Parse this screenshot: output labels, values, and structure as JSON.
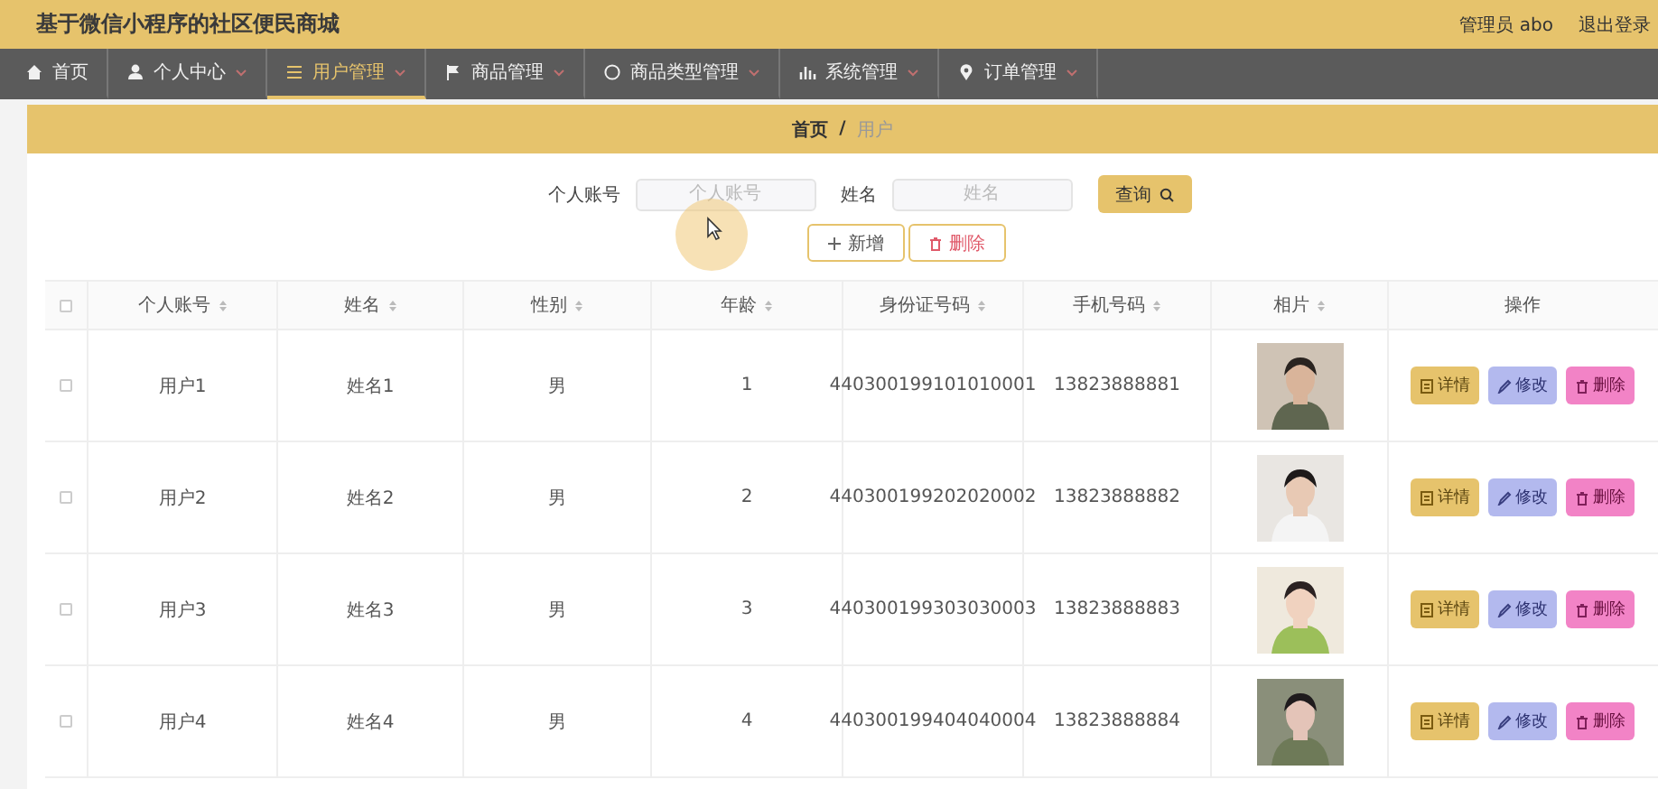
{
  "header": {
    "title": "基于微信小程序的社区便民商城",
    "user": "管理员 abo",
    "logout": "退出登录"
  },
  "nav": [
    {
      "label": "首页",
      "kind": "home",
      "caret": false,
      "selected": false
    },
    {
      "label": "个人中心",
      "kind": "person",
      "caret": true,
      "selected": false
    },
    {
      "label": "用户管理",
      "kind": "list",
      "caret": true,
      "selected": true
    },
    {
      "label": "商品管理",
      "kind": "flag",
      "caret": true,
      "selected": false
    },
    {
      "label": "商品类型管理",
      "kind": "circle",
      "caret": true,
      "selected": false
    },
    {
      "label": "系统管理",
      "kind": "chart",
      "caret": true,
      "selected": false
    },
    {
      "label": "订单管理",
      "kind": "pin",
      "caret": true,
      "selected": false
    }
  ],
  "breadcrumb": {
    "home": "首页",
    "separator": "/",
    "current": "用户"
  },
  "search": {
    "fields": [
      {
        "label": "个人账号",
        "placeholder": "个人账号"
      },
      {
        "label": "姓名",
        "placeholder": "姓名"
      }
    ],
    "button": "查询"
  },
  "actions": [
    {
      "kind": "add",
      "label": "新增"
    },
    {
      "kind": "delete",
      "label": "删除"
    }
  ],
  "table": {
    "columns": [
      {
        "label": "个人账号",
        "sortable": true
      },
      {
        "label": "姓名",
        "sortable": true
      },
      {
        "label": "性别",
        "sortable": true
      },
      {
        "label": "年龄",
        "sortable": true
      },
      {
        "label": "身份证号码",
        "sortable": true
      },
      {
        "label": "手机号码",
        "sortable": true
      },
      {
        "label": "相片",
        "sortable": true
      },
      {
        "label": "操作",
        "sortable": false
      }
    ],
    "header_checked": false,
    "rows": [
      {
        "checked": false,
        "cells": [
          "用户1",
          "姓名1",
          "男",
          "1",
          "440300199101010001",
          "13823888881"
        ],
        "photo": {
          "kind": "picture"
        },
        "buttons": [
          {
            "kind": "detail",
            "label": "详情"
          },
          {
            "kind": "edit",
            "label": "修改"
          },
          {
            "kind": "delete",
            "label": "删除"
          }
        ]
      },
      {
        "checked": false,
        "cells": [
          "用户2",
          "姓名2",
          "男",
          "2",
          "440300199202020002",
          "13823888882"
        ],
        "photo": {
          "kind": "picture"
        },
        "buttons": [
          {
            "kind": "detail",
            "label": "详情"
          },
          {
            "kind": "edit",
            "label": "修改"
          },
          {
            "kind": "delete",
            "label": "删除"
          }
        ]
      },
      {
        "checked": false,
        "cells": [
          "用户3",
          "姓名3",
          "男",
          "3",
          "440300199303030003",
          "13823888883"
        ],
        "photo": {
          "kind": "picture"
        },
        "buttons": [
          {
            "kind": "detail",
            "label": "详情"
          },
          {
            "kind": "edit",
            "label": "修改"
          },
          {
            "kind": "delete",
            "label": "删除"
          }
        ]
      },
      {
        "checked": false,
        "cells": [
          "用户4",
          "姓名4",
          "男",
          "4",
          "440300199404040004",
          "13823888884"
        ],
        "photo": {
          "kind": "picture"
        },
        "buttons": [
          {
            "kind": "detail",
            "label": "详情"
          },
          {
            "kind": "edit",
            "label": "修改"
          },
          {
            "kind": "delete",
            "label": "删除"
          }
        ]
      }
    ]
  }
}
